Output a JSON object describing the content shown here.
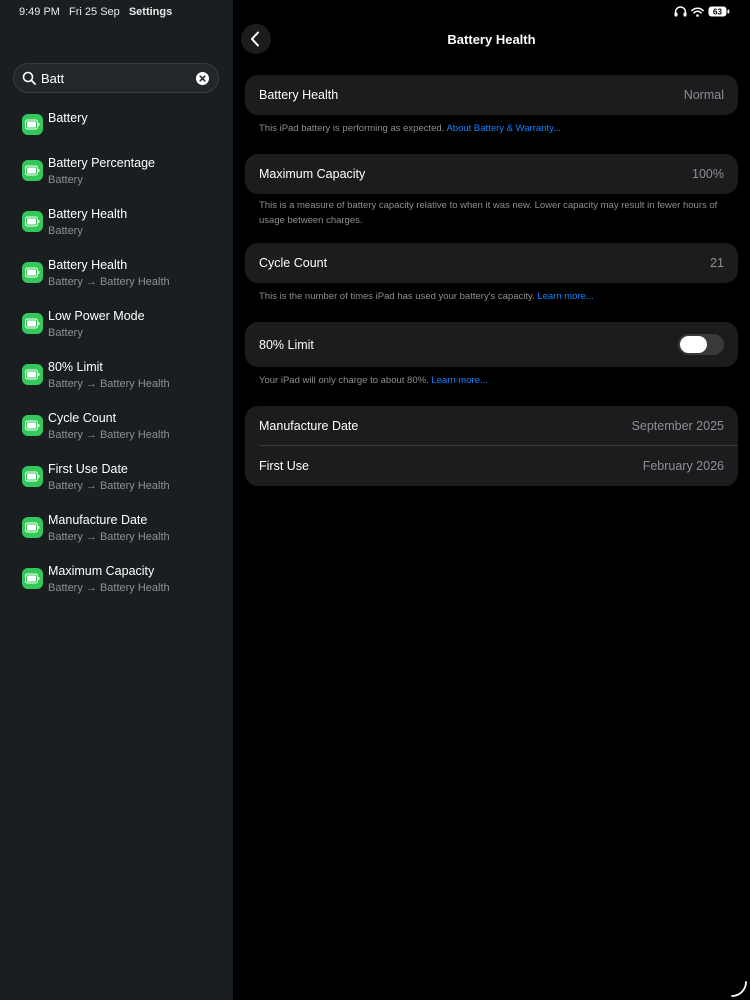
{
  "status": {
    "time": "9:49 PM",
    "date": "Fri 25 Sep",
    "app": "Settings",
    "battery_level": "63"
  },
  "search": {
    "value": "Batt"
  },
  "results": [
    {
      "title": "Battery",
      "subtitle": ""
    },
    {
      "title": "Battery Percentage",
      "subtitle": "Battery"
    },
    {
      "title": "Battery Health",
      "subtitle": "Battery"
    },
    {
      "title": "Battery Health",
      "subtitle": "Battery → Battery Health"
    },
    {
      "title": "Low Power Mode",
      "subtitle": "Battery"
    },
    {
      "title": "80% Limit",
      "subtitle": "Battery → Battery Health"
    },
    {
      "title": "Cycle Count",
      "subtitle": "Battery → Battery Health"
    },
    {
      "title": "First Use Date",
      "subtitle": "Battery → Battery Health"
    },
    {
      "title": "Manufacture Date",
      "subtitle": "Battery → Battery Health"
    },
    {
      "title": "Maximum Capacity",
      "subtitle": "Battery → Battery Health"
    }
  ],
  "main": {
    "title": "Battery Health",
    "health": {
      "label": "Battery Health",
      "value": "Normal",
      "note": "This iPad battery is performing as expected. ",
      "note_link": "About Battery & Warranty..."
    },
    "capacity": {
      "label": "Maximum Capacity",
      "value": "100%",
      "note": "This is a measure of battery capacity relative to when it was new. Lower capacity may result in fewer hours of usage between charges."
    },
    "cycle": {
      "label": "Cycle Count",
      "value": "21",
      "note": "This is the number of times iPad has used your battery's capacity. ",
      "note_link": "Learn more..."
    },
    "limit": {
      "label": "80% Limit",
      "enabled": false,
      "note": "Your iPad will only charge to about 80%. ",
      "note_link": "Learn more..."
    },
    "dates": {
      "manufacture_label": "Manufacture Date",
      "manufacture_value": "September 2025",
      "first_use_label": "First Use",
      "first_use_value": "February 2026"
    }
  },
  "colors": {
    "accent": "#0a84ff",
    "battery_green": "#34c759",
    "sidebar_bg": "#1b1e20",
    "card_bg": "#1c1c1e"
  }
}
